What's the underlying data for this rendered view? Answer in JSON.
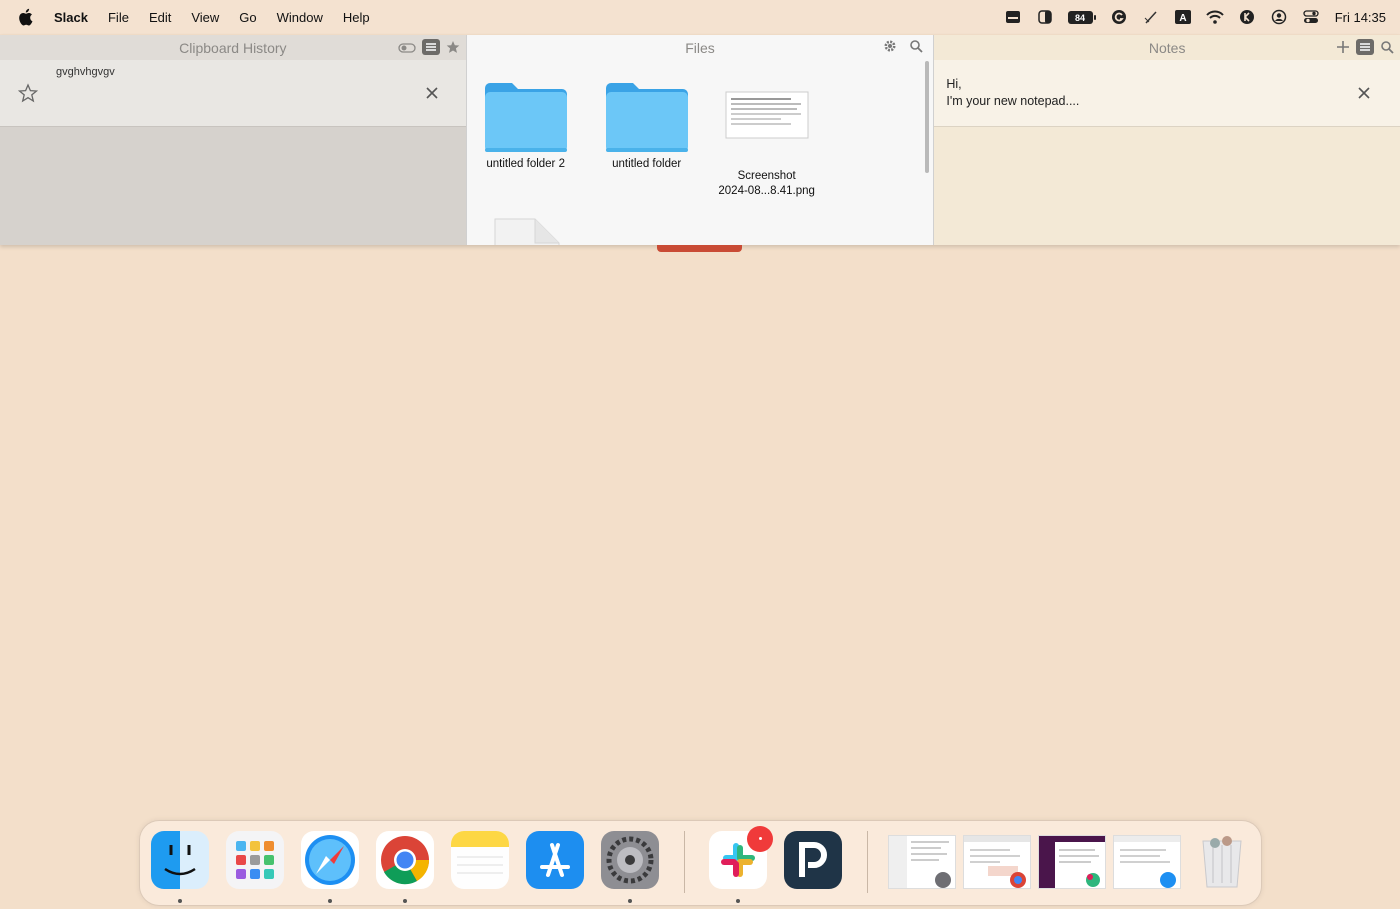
{
  "menubar": {
    "app": "Slack",
    "items": [
      "File",
      "Edit",
      "View",
      "Go",
      "Window",
      "Help"
    ],
    "battery": "84",
    "clock": "Fri 14:35",
    "tray_icons": [
      "printer-icon",
      "contrast-icon",
      "battery-icon",
      "grammarly-icon",
      "pen-icon",
      "text-input-icon",
      "wifi-icon",
      "k-icon",
      "user-icon",
      "control-center-icon"
    ]
  },
  "clipboard": {
    "title": "Clipboard History",
    "entry_text": "gvghvhgvgv"
  },
  "files": {
    "title": "Files",
    "items": [
      {
        "name": "untitled folder 2",
        "type": "folder"
      },
      {
        "name": "untitled folder",
        "type": "folder"
      },
      {
        "name_line1": "Screenshot",
        "name_line2": "2024-08...8.41.png",
        "type": "image"
      }
    ]
  },
  "notes": {
    "title": "Notes",
    "line1": "Hi,",
    "line2": "I'm your new notepad...."
  },
  "dock": {
    "apps": [
      "Finder",
      "Launchpad",
      "Safari",
      "Google Chrome",
      "Notes",
      "App Store",
      "System Settings",
      "Slack",
      "Pastebot"
    ],
    "accent": "#f3dfca"
  }
}
